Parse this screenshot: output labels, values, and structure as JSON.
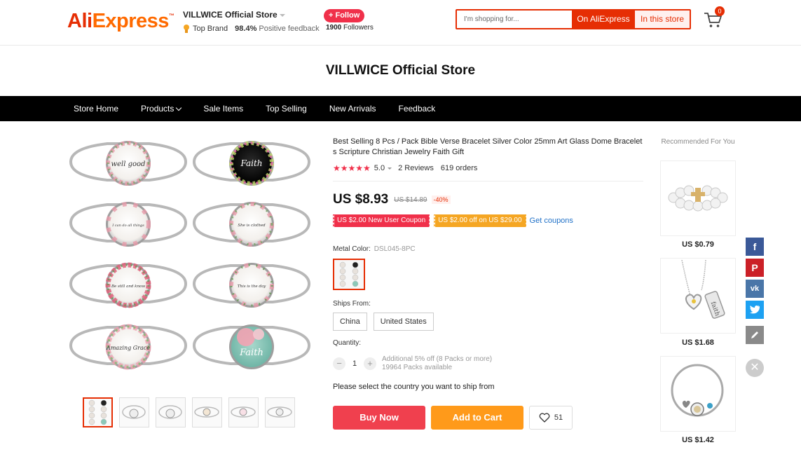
{
  "header": {
    "logo_text_a": "Ali",
    "logo_text_b": "Express",
    "store_name": "VILLWICE Official Store",
    "top_brand": "Top Brand",
    "positive_pct": "98.4%",
    "positive_label": "Positive feedback",
    "follow_label": "+ Follow",
    "followers_count": "1900",
    "followers_label": "Followers",
    "search_placeholder": "I'm shopping for...",
    "search_on_aliexpress": "On AliExpress",
    "search_in_store": "In this store",
    "cart_count": "0"
  },
  "banner": {
    "title": "VILLWICE Official Store"
  },
  "nav": {
    "items": [
      "Store Home",
      "Products",
      "Sale Items",
      "Top Selling",
      "New Arrivals",
      "Feedback"
    ]
  },
  "product": {
    "title": "Best Selling 8 Pcs / Pack Bible Verse Bracelet Silver Color 25mm Art Glass Dome Bracelets Scripture Christian Jewelry Faith Gift",
    "stars": "★★★★★",
    "rating": "5.0",
    "reviews": "2 Reviews",
    "orders": "619 orders",
    "price": "US $8.93",
    "old_price": "US $14.89",
    "discount": "-40%",
    "coupon_new_user": "US $2.00 New User Coupon",
    "coupon_off": "US $2.00 off on US $29.00",
    "get_coupons": "Get coupons",
    "metal_color_label": "Metal Color:",
    "metal_color_value": "DSL045-8PC",
    "ships_from_label": "Ships From:",
    "ships_from_options": [
      "China",
      "United States"
    ],
    "quantity_label": "Quantity:",
    "quantity_value": "1",
    "qty_minus": "−",
    "qty_plus": "+",
    "qty_discount": "Additional 5% off (8 Packs or more)",
    "qty_available": "19964 Packs available",
    "ship_note": "Please select the country you want to ship from",
    "buy_now": "Buy Now",
    "add_to_cart": "Add to Cart",
    "wishlist_count": "51"
  },
  "gallery": {
    "bracelet_texts": [
      "well good",
      "Faith",
      "I can do all things",
      "She is clothed",
      "Be still and know",
      "This is the day",
      "Amazing Grace",
      "Faith"
    ]
  },
  "recommended": {
    "title": "Recommended For You",
    "items": [
      {
        "price": "US $0.79"
      },
      {
        "price": "US $1.68"
      },
      {
        "price": "US $1.42"
      }
    ]
  },
  "colors": {
    "brand_red": "#e62e04",
    "buy_red": "#f0404e",
    "cart_orange": "#ff9a1a",
    "facebook": "#3b5998",
    "pinterest": "#cb2027",
    "vk": "#4a76a8",
    "twitter": "#1da1f2"
  }
}
